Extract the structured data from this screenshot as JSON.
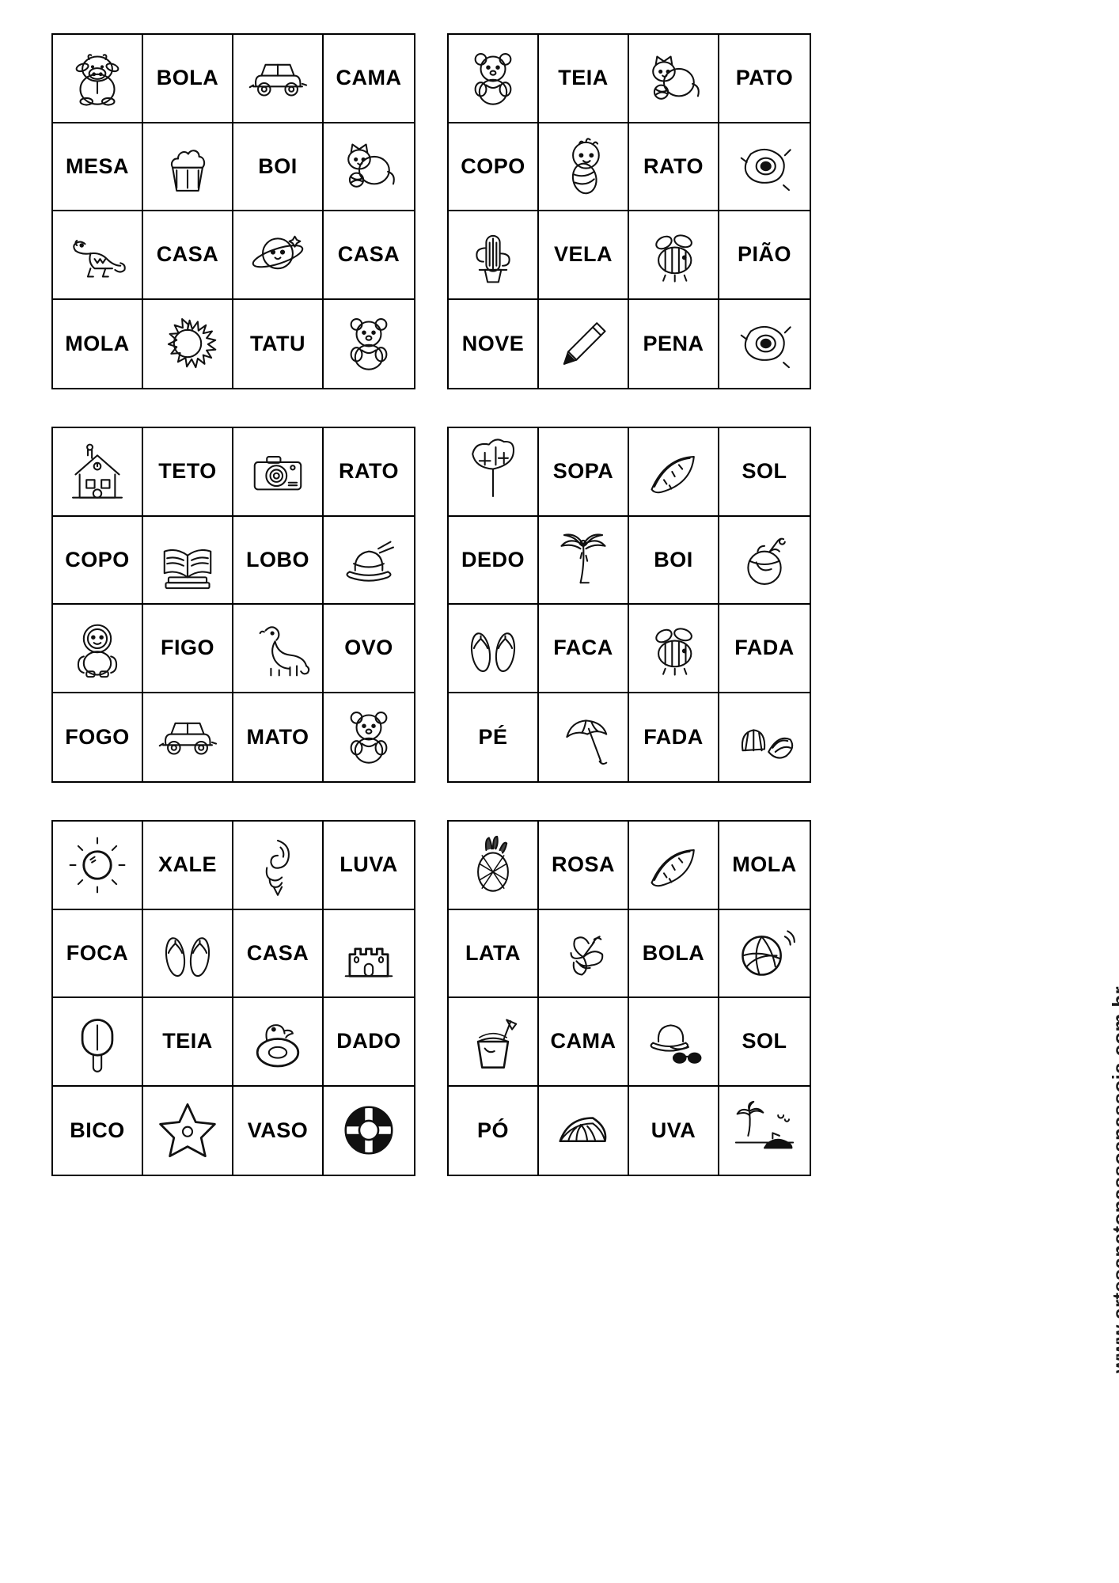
{
  "page": {
    "watermark": "www.artesanatopassoapassoja.com.br",
    "ink_color": "#000000",
    "background_color": "#ffffff",
    "card_count": 6,
    "grid": "4x4"
  },
  "cards": [
    {
      "id": "card-1",
      "position": "top-left",
      "cells": [
        {
          "type": "image",
          "icon": "cow-plush-icon",
          "label": "VACA"
        },
        {
          "type": "word",
          "text": "BOLA"
        },
        {
          "type": "image",
          "icon": "car-icon",
          "label": "CARRO"
        },
        {
          "type": "word",
          "text": "CAMA"
        },
        {
          "type": "word",
          "text": "MESA"
        },
        {
          "type": "image",
          "icon": "cupcake-icon",
          "label": "BOLO"
        },
        {
          "type": "word",
          "text": "BOI"
        },
        {
          "type": "image",
          "icon": "cat-yarn-icon",
          "label": "GATO"
        },
        {
          "type": "image",
          "icon": "crocodile-icon",
          "label": "JACARE"
        },
        {
          "type": "word",
          "text": "CASA"
        },
        {
          "type": "image",
          "icon": "planet-icon",
          "label": "PLANETA"
        },
        {
          "type": "word",
          "text": "CASA"
        },
        {
          "type": "word",
          "text": "MOLA"
        },
        {
          "type": "image",
          "icon": "sun-spiky-icon",
          "label": "SOL"
        },
        {
          "type": "word",
          "text": "TATU"
        },
        {
          "type": "image",
          "icon": "teddy-bear-icon",
          "label": "URSO"
        }
      ]
    },
    {
      "id": "card-2",
      "position": "top-right",
      "cells": [
        {
          "type": "image",
          "icon": "teddy-bear-icon",
          "label": "URSO"
        },
        {
          "type": "word",
          "text": "TEIA"
        },
        {
          "type": "image",
          "icon": "cat-yarn-icon",
          "label": "GATO"
        },
        {
          "type": "word",
          "text": "PATO"
        },
        {
          "type": "word",
          "text": "COPO"
        },
        {
          "type": "image",
          "icon": "baby-icon",
          "label": "BEBE"
        },
        {
          "type": "word",
          "text": "RATO"
        },
        {
          "type": "image",
          "icon": "fried-egg-icon",
          "label": "OVO"
        },
        {
          "type": "image",
          "icon": "cactus-icon",
          "label": "CACTO"
        },
        {
          "type": "word",
          "text": "VELA"
        },
        {
          "type": "image",
          "icon": "bee-icon",
          "label": "ABELHA"
        },
        {
          "type": "word",
          "text": "PIÃO"
        },
        {
          "type": "word",
          "text": "NOVE"
        },
        {
          "type": "image",
          "icon": "pencil-icon",
          "label": "LAPIS"
        },
        {
          "type": "word",
          "text": "PENA"
        },
        {
          "type": "image",
          "icon": "fried-egg-icon",
          "label": "OVO"
        }
      ]
    },
    {
      "id": "card-3",
      "position": "middle-left",
      "cells": [
        {
          "type": "image",
          "icon": "house-icon",
          "label": "CASA"
        },
        {
          "type": "word",
          "text": "TETO"
        },
        {
          "type": "image",
          "icon": "camera-icon",
          "label": "CAMERA"
        },
        {
          "type": "word",
          "text": "RATO"
        },
        {
          "type": "word",
          "text": "COPO"
        },
        {
          "type": "image",
          "icon": "books-icon",
          "label": "LIVRO"
        },
        {
          "type": "word",
          "text": "LOBO"
        },
        {
          "type": "image",
          "icon": "hat-icon",
          "label": "CHAPEU"
        },
        {
          "type": "image",
          "icon": "astronaut-bear-icon",
          "label": "ASTRONAUTA"
        },
        {
          "type": "word",
          "text": "FIGO"
        },
        {
          "type": "image",
          "icon": "dinosaur-icon",
          "label": "DINOSSAURO"
        },
        {
          "type": "word",
          "text": "OVO"
        },
        {
          "type": "word",
          "text": "FOGO"
        },
        {
          "type": "image",
          "icon": "car-icon",
          "label": "CARRO"
        },
        {
          "type": "word",
          "text": "MATO"
        },
        {
          "type": "image",
          "icon": "teddy-bear-icon",
          "label": "URSO"
        }
      ]
    },
    {
      "id": "card-4",
      "position": "middle-right",
      "cells": [
        {
          "type": "image",
          "icon": "monstera-leaf-icon",
          "label": "FOLHA"
        },
        {
          "type": "word",
          "text": "SOPA"
        },
        {
          "type": "image",
          "icon": "watermelon-icon",
          "label": "MELANCIA"
        },
        {
          "type": "word",
          "text": "SOL"
        },
        {
          "type": "word",
          "text": "DEDO"
        },
        {
          "type": "image",
          "icon": "palm-tree-icon",
          "label": "COQUEIRO"
        },
        {
          "type": "word",
          "text": "BOI"
        },
        {
          "type": "image",
          "icon": "coconut-drink-icon",
          "label": "COCO"
        },
        {
          "type": "image",
          "icon": "flip-flops-icon",
          "label": "CHINELO"
        },
        {
          "type": "word",
          "text": "FACA"
        },
        {
          "type": "image",
          "icon": "bee-icon",
          "label": "ABELHA"
        },
        {
          "type": "word",
          "text": "FADA"
        },
        {
          "type": "word",
          "text": "PÉ"
        },
        {
          "type": "image",
          "icon": "beach-umbrella-icon",
          "label": "GUARDA-SOL"
        },
        {
          "type": "word",
          "text": "FADA"
        },
        {
          "type": "image",
          "icon": "seashells-icon",
          "label": "CONCHA"
        }
      ]
    },
    {
      "id": "card-5",
      "position": "bottom-left",
      "cells": [
        {
          "type": "image",
          "icon": "sun-rays-icon",
          "label": "SOL"
        },
        {
          "type": "word",
          "text": "XALE"
        },
        {
          "type": "image",
          "icon": "spiral-shell-icon",
          "label": "CONCHA"
        },
        {
          "type": "word",
          "text": "LUVA"
        },
        {
          "type": "word",
          "text": "FOCA"
        },
        {
          "type": "image",
          "icon": "flip-flops-icon",
          "label": "CHINELO"
        },
        {
          "type": "word",
          "text": "CASA"
        },
        {
          "type": "image",
          "icon": "sandcastle-icon",
          "label": "CASTELO"
        },
        {
          "type": "image",
          "icon": "popsicle-icon",
          "label": "PICOLE"
        },
        {
          "type": "word",
          "text": "TEIA"
        },
        {
          "type": "image",
          "icon": "duck-float-icon",
          "label": "BOIA"
        },
        {
          "type": "word",
          "text": "DADO"
        },
        {
          "type": "word",
          "text": "BICO"
        },
        {
          "type": "image",
          "icon": "starfish-icon",
          "label": "ESTRELA"
        },
        {
          "type": "word",
          "text": "VASO"
        },
        {
          "type": "image",
          "icon": "lifebuoy-icon",
          "label": "BOIA"
        }
      ]
    },
    {
      "id": "card-6",
      "position": "bottom-right",
      "cells": [
        {
          "type": "image",
          "icon": "pineapple-icon",
          "label": "ABACAXI"
        },
        {
          "type": "word",
          "text": "ROSA"
        },
        {
          "type": "image",
          "icon": "watermelon-icon",
          "label": "MELANCIA"
        },
        {
          "type": "word",
          "text": "MOLA"
        },
        {
          "type": "word",
          "text": "LATA"
        },
        {
          "type": "image",
          "icon": "hibiscus-icon",
          "label": "FLOR"
        },
        {
          "type": "word",
          "text": "BOLA"
        },
        {
          "type": "image",
          "icon": "volleyball-icon",
          "label": "BOLA"
        },
        {
          "type": "image",
          "icon": "sand-bucket-icon",
          "label": "BALDE"
        },
        {
          "type": "word",
          "text": "CAMA"
        },
        {
          "type": "image",
          "icon": "hat-sunglasses-icon",
          "label": "CHAPEU"
        },
        {
          "type": "word",
          "text": "SOL"
        },
        {
          "type": "word",
          "text": "PÓ"
        },
        {
          "type": "image",
          "icon": "orange-slice-icon",
          "label": "LARANJA"
        },
        {
          "type": "word",
          "text": "UVA"
        },
        {
          "type": "image",
          "icon": "beach-scene-icon",
          "label": "PRAIA"
        }
      ]
    }
  ]
}
